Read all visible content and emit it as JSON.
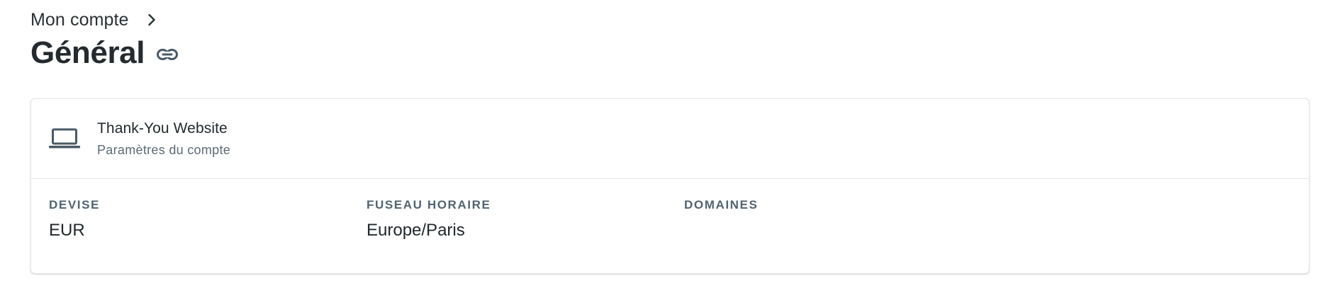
{
  "breadcrumb": {
    "parent_label": "Mon compte",
    "separator_icon": "chevron-right-icon"
  },
  "header": {
    "title": "Général",
    "link_icon": "link-icon"
  },
  "account_card": {
    "icon": "laptop-icon",
    "name": "Thank-You Website",
    "subtitle": "Paramètres du compte",
    "fields": [
      {
        "label": "DEVISE",
        "value": "EUR"
      },
      {
        "label": "FUSEAU HORAIRE",
        "value": "Europe/Paris"
      },
      {
        "label": "DOMAINES",
        "value": ""
      }
    ]
  },
  "colors": {
    "text_primary": "#22282c",
    "text_secondary": "#5b6b75",
    "label": "#526370",
    "border": "#e3e6e8",
    "icon": "#4a5a66"
  }
}
